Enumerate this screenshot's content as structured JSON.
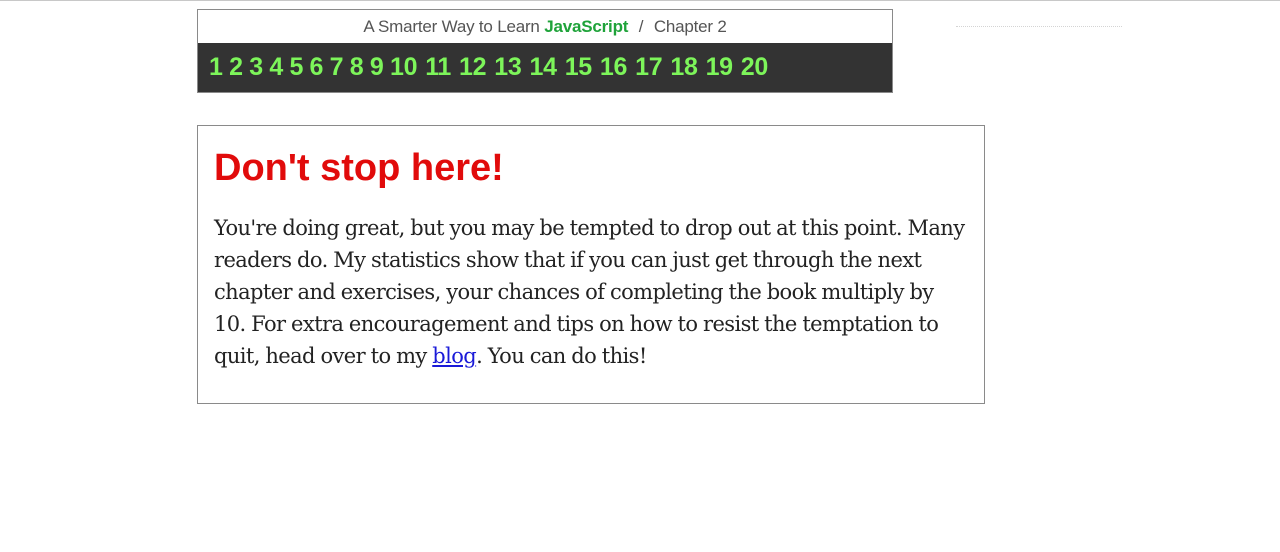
{
  "header": {
    "prefix": "A Smarter Way to Learn",
    "brand": "JavaScript",
    "separator": "/",
    "chapter": "Chapter 2",
    "brand_color": "#1fa33a"
  },
  "exercise_nav": {
    "link_color": "#7df55a",
    "bar_color": "#333333",
    "items": [
      "1",
      "2",
      "3",
      "4",
      "5",
      "6",
      "7",
      "8",
      "9",
      "10",
      "11",
      "12",
      "13",
      "14",
      "15",
      "16",
      "17",
      "18",
      "19",
      "20"
    ]
  },
  "message": {
    "title": "Don't stop here!",
    "title_color": "#e10b0b",
    "body_before": "You're doing great, but you may be tempted to drop out at this point. Many readers do. My statistics show that if you can just get through the next chapter and exercises, your chances of completing the book multiply by 10. For extra encouragement and tips on how to resist the temptation to quit, head over to my ",
    "link_label": "blog",
    "body_after": ". You can do this!"
  }
}
